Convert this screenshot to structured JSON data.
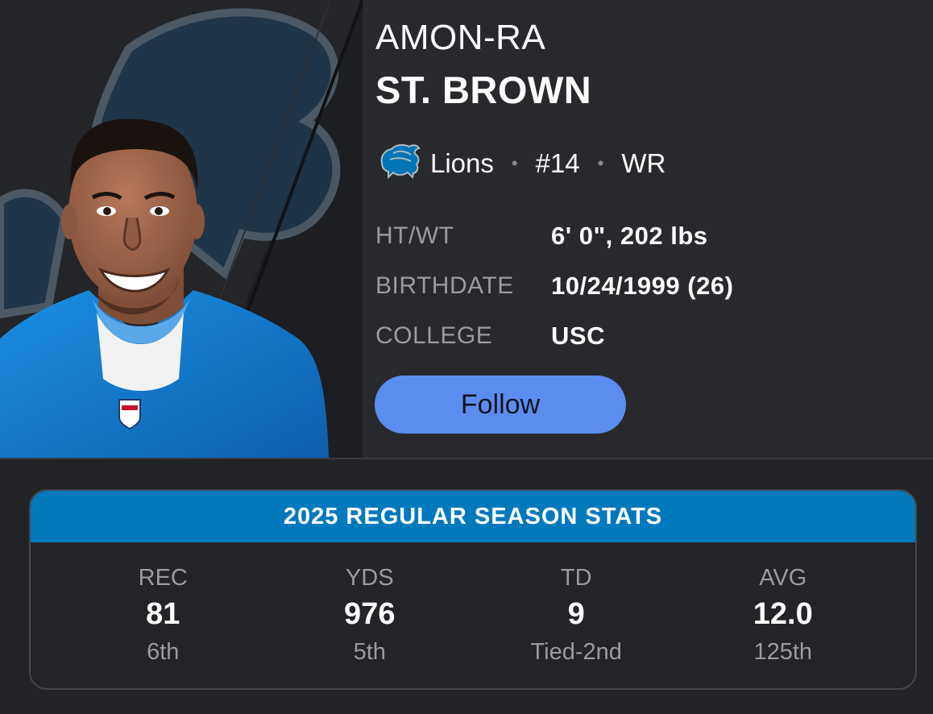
{
  "player": {
    "first_name": "AMON-RA",
    "last_name": "ST. BROWN",
    "team": "Lions",
    "number": "#14",
    "position": "WR"
  },
  "bio": [
    {
      "label": "HT/WT",
      "value": "6' 0\", 202 lbs"
    },
    {
      "label": "BIRTHDATE",
      "value": "10/24/1999 (26)"
    },
    {
      "label": "COLLEGE",
      "value": "USC"
    }
  ],
  "follow_label": "Follow",
  "stats": {
    "title": "2025 REGULAR SEASON STATS",
    "items": [
      {
        "label": "REC",
        "value": "81",
        "rank": "6th"
      },
      {
        "label": "YDS",
        "value": "976",
        "rank": "5th"
      },
      {
        "label": "TD",
        "value": "9",
        "rank": "Tied-2nd"
      },
      {
        "label": "AVG",
        "value": "12.0",
        "rank": "125th"
      }
    ]
  },
  "colors": {
    "background": "#222326",
    "header_background": "#28292c",
    "accent_button": "#5b8df0",
    "stats_header": "#0379bd",
    "lions_blue": "#0076b6",
    "muted_text": "#9a9b9f"
  },
  "icons": {
    "team_logo": "lions-logo-icon",
    "separator": "dot-separator"
  }
}
